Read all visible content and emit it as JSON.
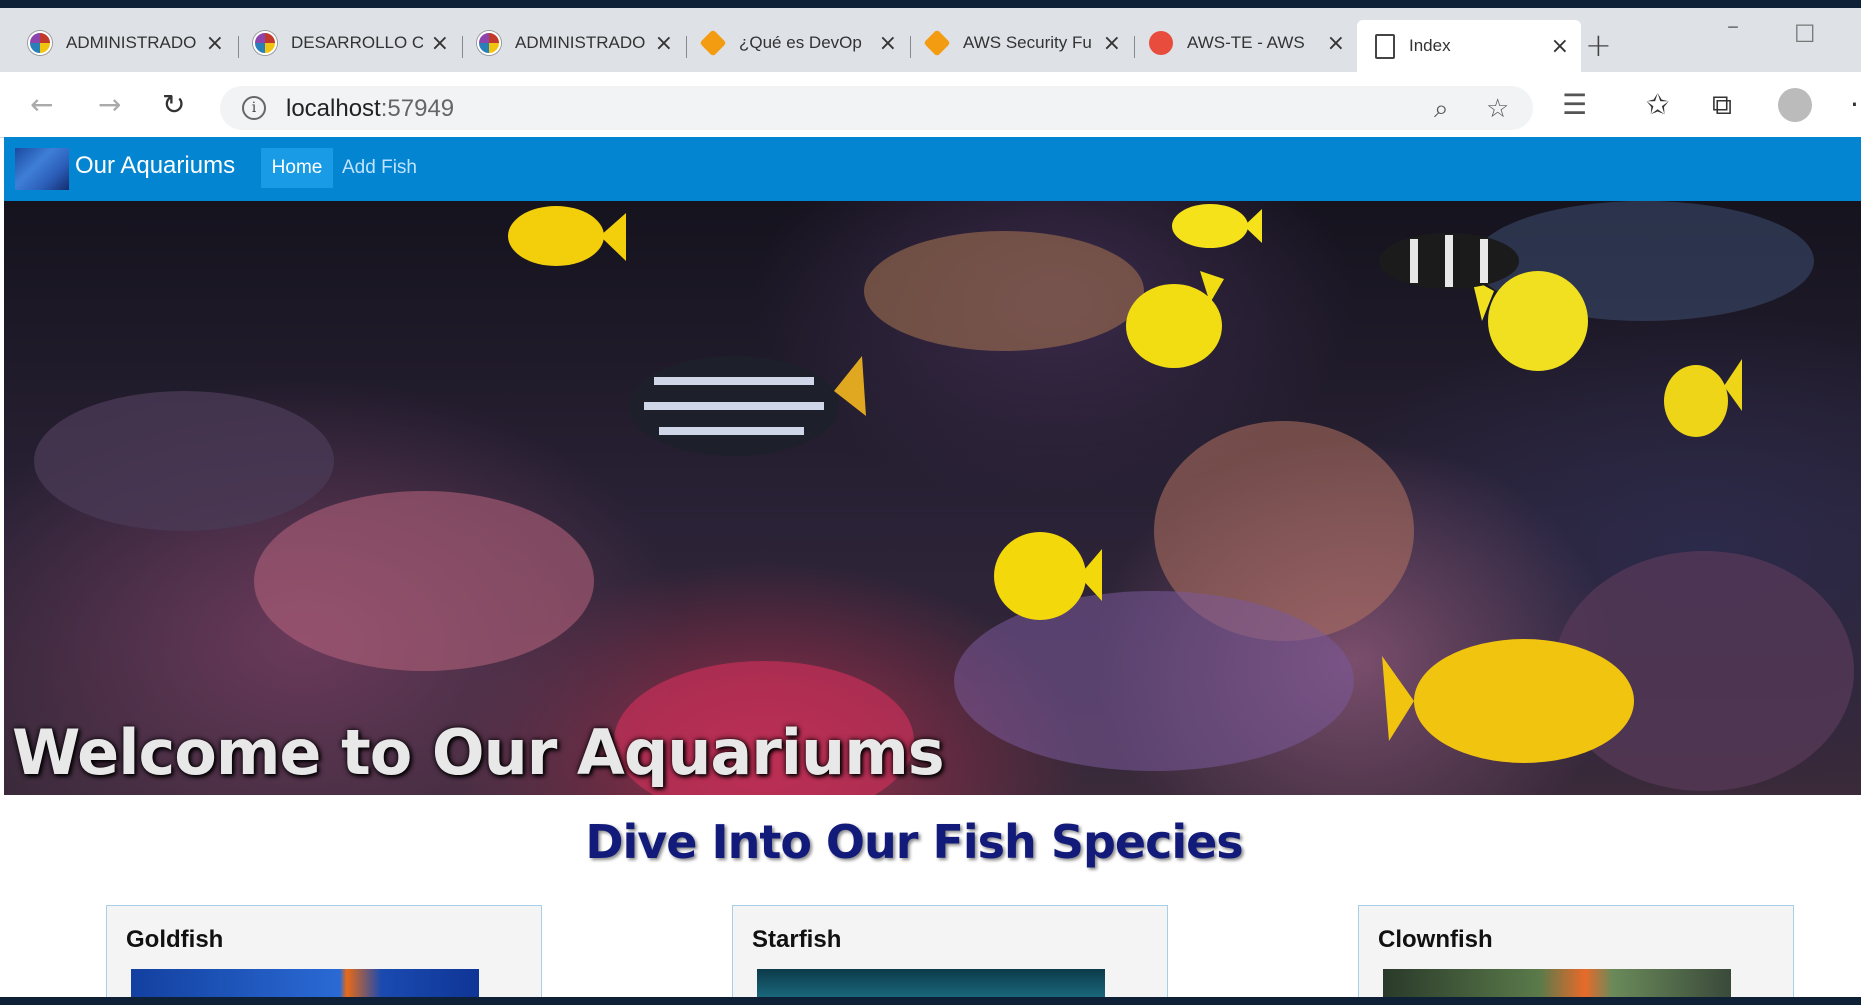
{
  "browser": {
    "tabs": [
      {
        "title": "ADMINISTRADO",
        "icon": "org-logo-icon"
      },
      {
        "title": "DESARROLLO C",
        "icon": "org-logo-icon"
      },
      {
        "title": "ADMINISTRADO",
        "icon": "org-logo-icon"
      },
      {
        "title": "¿Qué es DevOp",
        "icon": "aws-cube-icon"
      },
      {
        "title": "AWS Security Fu",
        "icon": "aws-cube-icon"
      },
      {
        "title": "AWS-TE - AWS",
        "icon": "aws-te-icon"
      },
      {
        "title": "Index",
        "icon": "page-icon"
      }
    ],
    "close_glyph": "×",
    "new_tab_glyph": "+",
    "url_host": "localhost",
    "url_port": ":57949"
  },
  "site": {
    "brand": "Our Aquariums",
    "nav": {
      "home": "Home",
      "add_fish": "Add Fish"
    },
    "hero_heading": "Welcome to Our Aquariums",
    "section_title": "Dive Into Our Fish Species",
    "cards": [
      {
        "name": "Goldfish"
      },
      {
        "name": "Starfish"
      },
      {
        "name": "Clownfish"
      }
    ]
  },
  "colors": {
    "navbar": "#0385d1",
    "heading": "#121a7a"
  }
}
